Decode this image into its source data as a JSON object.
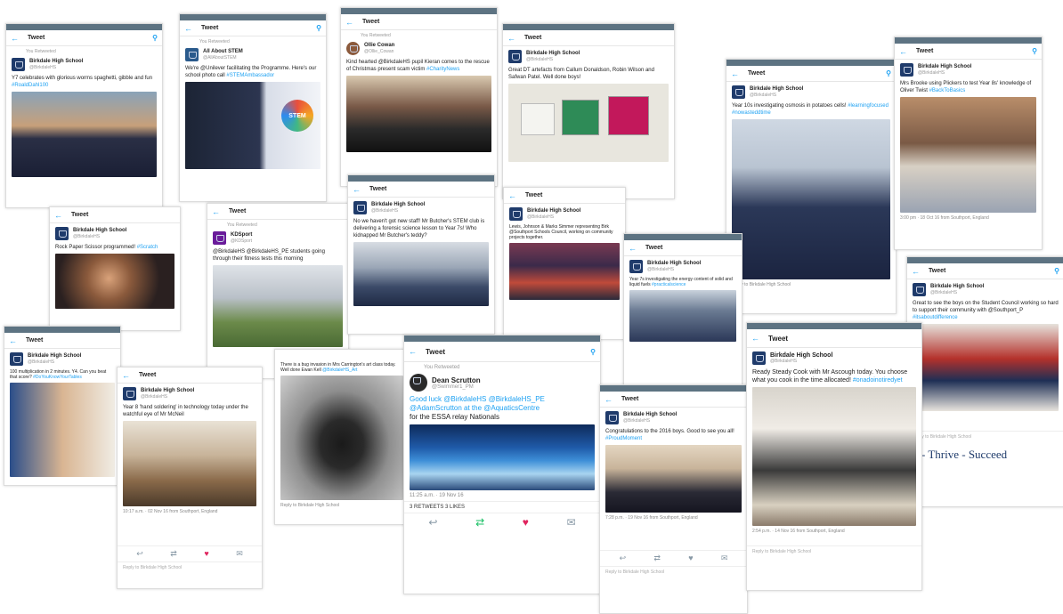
{
  "common": {
    "tweet_title": "Tweet",
    "you_retweeted": "You Retweeted",
    "school_name": "Birkdale High School",
    "school_handle": "@BirkdaleHS",
    "reply_placeholder": "Reply to Birkdale High School",
    "retweets_likes": "3 RETWEETS 3 LIKES",
    "slogan": "- Thrive - Succeed"
  },
  "tweets": {
    "t1": {
      "text_a": "Y7 celebrates with glorious worms spaghetti, gibble and fun",
      "text_b": "#RoaldDahl100"
    },
    "t2": {
      "name": "All About STEM",
      "handle": "@AllAboutSTEM",
      "text": "We're @Unilever facilitating the Programme. Here's our school photo call",
      "tag": "#STEMAmbassador",
      "stem_logo": "STEM"
    },
    "t3": {
      "name": "Ollie Cowan",
      "handle": "@Ollie_Cowan",
      "text": "Kind hearted @BirkdaleHS pupil Kieran comes to the rescue of Christmas present scam victim",
      "tag": "#CharityNews"
    },
    "t4": {
      "text": "Great DT artefacts from Callum Donaldson, Robin Wilson and Safwan Patel. Well done boys!"
    },
    "t5": {
      "text": "Year 10s investigating osmosis in potatoes cells!",
      "tag": "#learningfocused #nowasteddtime",
      "footer": "Reply to Birkdale High School"
    },
    "t6": {
      "text": "Mrs Brooke using Plickers to test Year 8s' knowledge of Oliver Twist",
      "tag": "#BackToBasics",
      "meta": "3:00 pm · 18 Oct 16 from Southport, England"
    },
    "t7": {
      "text": "Rock Paper Scissor programmed!",
      "tag": "#Scratch"
    },
    "t8": {
      "name": "KDSport",
      "handle": "@KDSport",
      "text": "@BirkdaleHS @BirkdaleHS_PE students going through their fitness tests this morning"
    },
    "t9": {
      "text": "No we haven't got new staff! Mr Butcher's STEM club is delivering a forensic science lesson to Year 7s! Who kidnapped Mr Butcher's teddy?"
    },
    "t10": {
      "text": "Lewis, Johnson & Marks Simmer representing Birk @Southport Schools Council, working on community projects together."
    },
    "t11": {
      "text": "Year 7s investigating the energy content of solid and liquid fuels",
      "tag": "#practicalscience"
    },
    "t12": {
      "text": "Great to see the boys on the Student Council working so hard to support their community with @Southport_P",
      "tag": "#itsaboutdifference"
    },
    "t13": {
      "text": "100 multiplication in 2 minutes. Y4. Can you beat that score?",
      "tag": "#DoYouKnowYourTables"
    },
    "t14": {
      "text": "Year 8 'hand soldering' in technology today under the watchful eye of Mr McNeil",
      "meta": "10:17 a.m. · 02 Nov 16 from Southport, England"
    },
    "t15": {
      "text": "There is a bug invasion in Mrs Carrington's art class today. Well done Ewan Kell",
      "tag": "@BirkdaleHS_Art",
      "footer": "Reply to Birkdale High School"
    },
    "t16": {
      "name": "Dean Scrutton",
      "handle": "@Swimmer1_PM",
      "text_a": "Good luck @BirkdaleHS @BirkdaleHS_PE",
      "text_b": "@AdamScrutton at the @AquaticsCentre",
      "text_c": "for the ESSA relay Nationals",
      "meta": "11:25 a.m. · 19 Nov 16"
    },
    "t17": {
      "text": "Congratulations to the 2016 boys. Good to see you all!",
      "tag": "#ProudMoment",
      "meta": "7:28 p.m. · 19 Nov 16 from Southport, England"
    },
    "t18": {
      "text": "Ready Steady Cook with Mr Ascough today. You choose what you cook in the time allocated!",
      "tag": "#onadoinotiredyet",
      "meta": "2:54 p.m. · 14 Nov 16 from Southport, England"
    }
  },
  "actions": {
    "reply": "↩",
    "retweet": "⇄",
    "like": "♥",
    "dm": "✉"
  },
  "colors": {
    "link": "#1da1f2",
    "status_bar": "#5d7382",
    "like": "#e0245e",
    "retweet": "#17bf63"
  }
}
